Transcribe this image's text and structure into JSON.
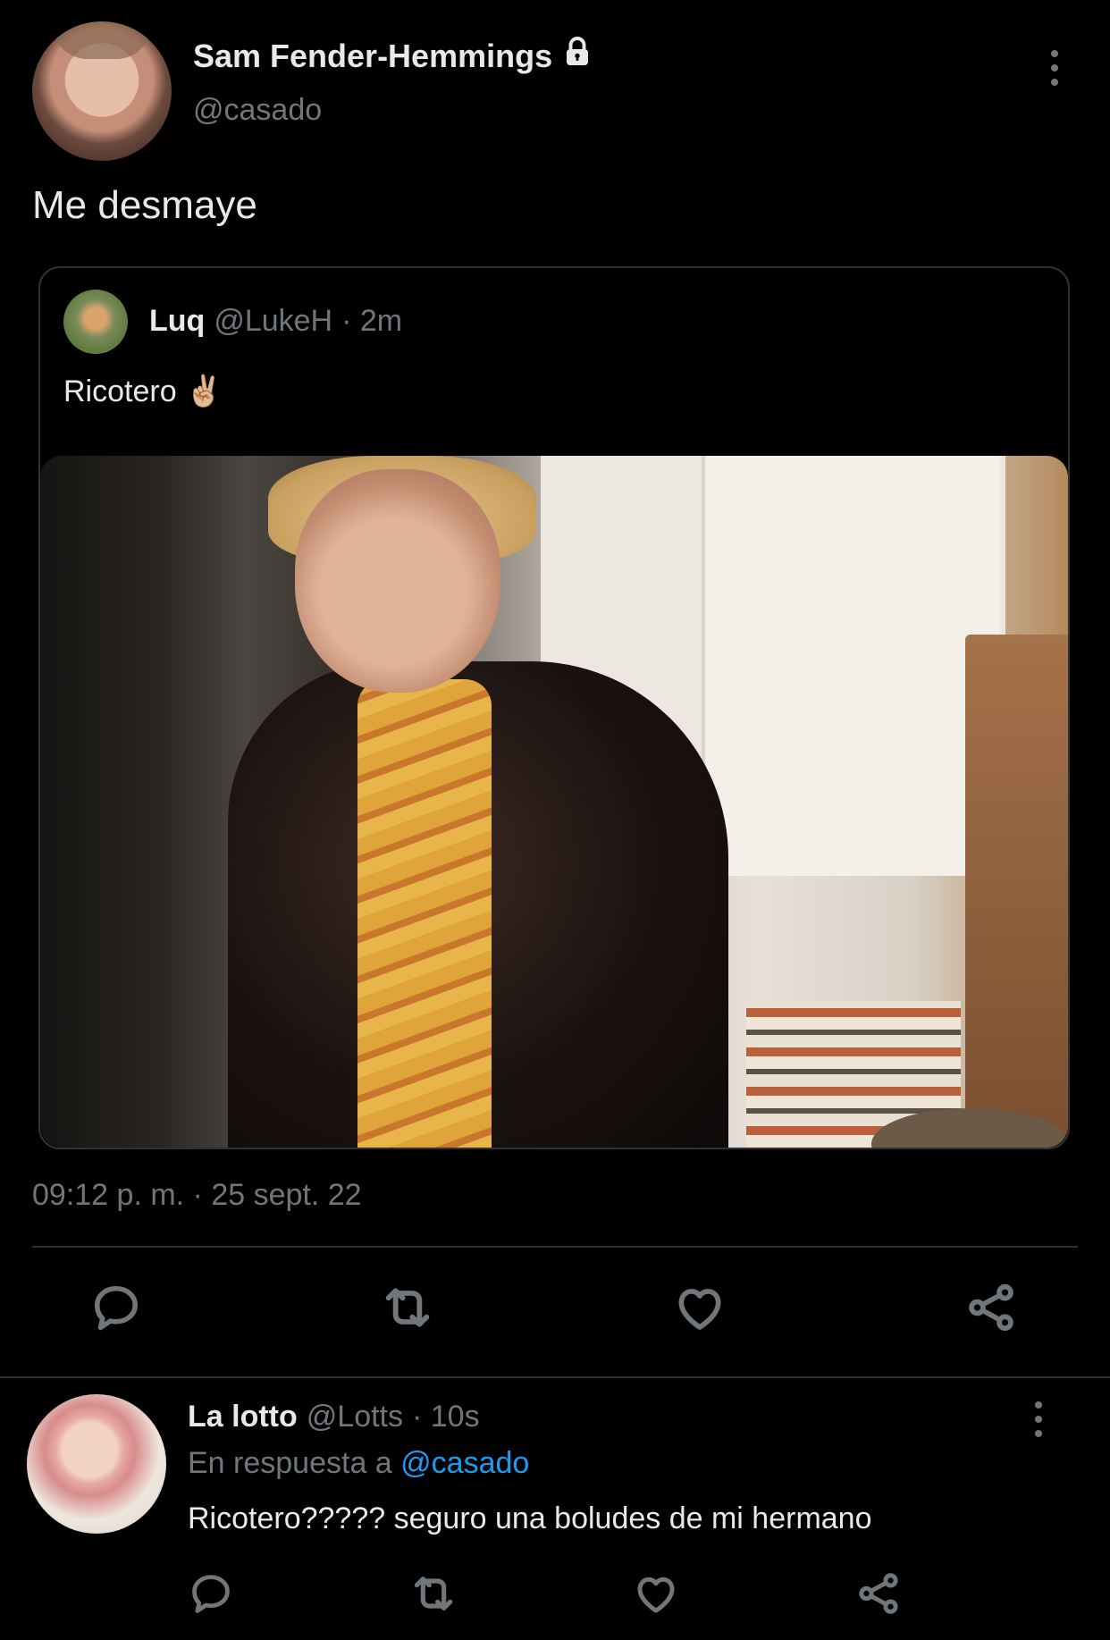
{
  "tweet": {
    "author_name": "Sam Fender-Hemmings",
    "author_handle": "@casado",
    "text": "Me desmaye",
    "timestamp": "09:12 p. m. · 25 sept. 22",
    "protected_icon": "lock-icon",
    "more_icon": "more-vertical-icon"
  },
  "quoted": {
    "author_name": "Luq",
    "author_handle": "@LukeH",
    "meta": "· 2m",
    "text": "Ricotero ✌🏼"
  },
  "actions": [
    {
      "name": "reply",
      "icon": "comment-icon"
    },
    {
      "name": "retweet",
      "icon": "retweet-icon"
    },
    {
      "name": "like",
      "icon": "heart-icon"
    },
    {
      "name": "share",
      "icon": "share-icon"
    }
  ],
  "reply": {
    "author_name": "La lotto",
    "author_handle": "@Lotts",
    "meta": "· 10s",
    "replying_prefix": "En respuesta a",
    "replying_handle": "@casado",
    "text": "Ricotero????? seguro una boludes de mi hermano"
  },
  "colors": {
    "background": "#000000",
    "text": "#e7e9ea",
    "muted": "#71767b",
    "link": "#1d9bf0",
    "border": "#2f3336"
  }
}
